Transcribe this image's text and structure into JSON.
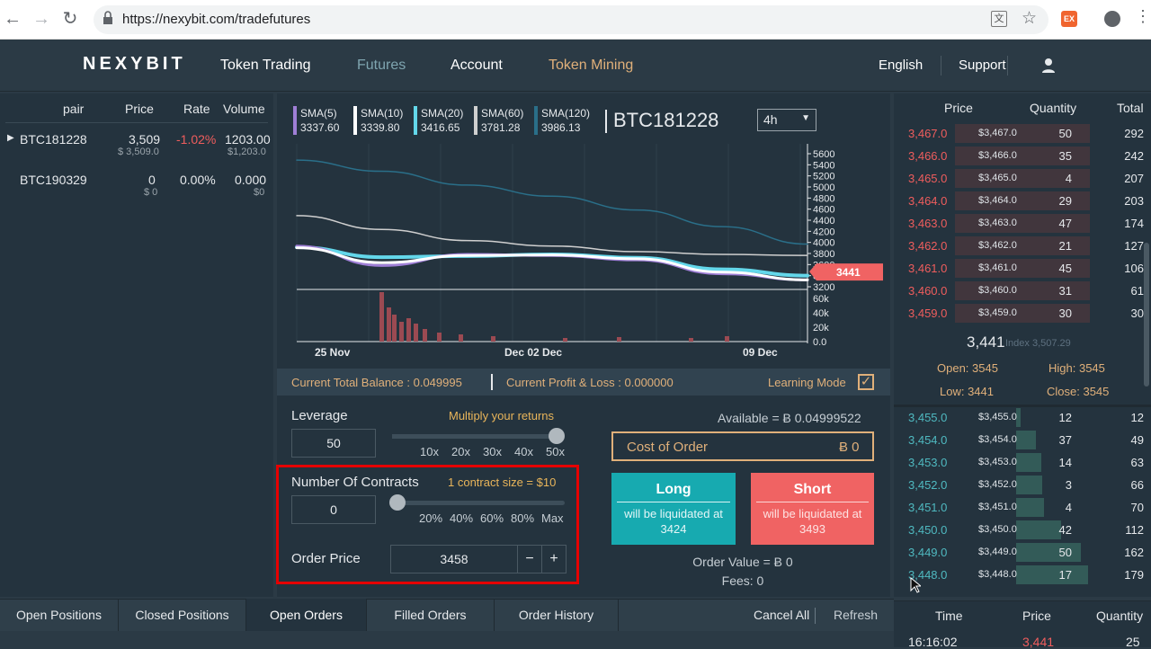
{
  "browser": {
    "url": "https://nexybit.com/tradefutures"
  },
  "header": {
    "logo": "NEXYBIT",
    "nav": [
      "Token Trading",
      "Futures",
      "Account",
      "Token Mining"
    ],
    "language": "English",
    "support": "Support"
  },
  "pairs": {
    "headers": [
      "pair",
      "Price",
      "Rate",
      "Volume"
    ],
    "rows": [
      {
        "pair": "BTC181228",
        "price": "3,509",
        "price_usd": "$ 3,509.0",
        "rate": "-1.02%",
        "volume": "1203.00",
        "volume_usd": "$1,203.0"
      },
      {
        "pair": "BTC190329",
        "price": "0",
        "price_usd": "$ 0",
        "rate": "0.00%",
        "volume": "0.000",
        "volume_usd": "$0"
      }
    ]
  },
  "chart": {
    "sma": [
      {
        "label": "SMA(5)",
        "value": "3337.60",
        "color": "#9f7fd6"
      },
      {
        "label": "SMA(10)",
        "value": "3339.80",
        "color": "#ffffff"
      },
      {
        "label": "SMA(20)",
        "value": "3416.65",
        "color": "#63d7ea"
      },
      {
        "label": "SMA(60)",
        "value": "3781.28",
        "color": "#cfcfcf"
      },
      {
        "label": "SMA(120)",
        "value": "3986.13",
        "color": "#2a6f89"
      }
    ],
    "symbol": "BTC181228",
    "interval": "4h",
    "last_price": "3441",
    "price_ticks": [
      "5600",
      "5400",
      "5200",
      "5000",
      "4800",
      "4600",
      "4400",
      "4200",
      "4000",
      "3800",
      "3600",
      "3400",
      "3200"
    ],
    "volume_ticks": [
      "60k",
      "40k",
      "20k",
      "0.0"
    ],
    "x_ticks": [
      "25 Nov",
      "Dec 02 Dec",
      "09 Dec"
    ]
  },
  "chart_data": {
    "type": "line",
    "title": "BTC181228",
    "x_ticks": [
      "25 Nov",
      "Dec 02 Dec",
      "09 Dec"
    ],
    "ylim": [
      3200,
      5600
    ],
    "series": [
      {
        "name": "SMA(5)",
        "values": [
          3950,
          3600,
          3800,
          3780,
          3700,
          3450,
          3340
        ]
      },
      {
        "name": "SMA(10)",
        "values": [
          3920,
          3650,
          3780,
          3790,
          3720,
          3480,
          3340
        ]
      },
      {
        "name": "SMA(20)",
        "values": [
          3930,
          3750,
          3770,
          3800,
          3740,
          3530,
          3417
        ]
      },
      {
        "name": "SMA(60)",
        "values": [
          4500,
          4250,
          4050,
          3950,
          3850,
          3800,
          3781
        ]
      },
      {
        "name": "SMA(120)",
        "values": [
          5500,
          5300,
          5050,
          4850,
          4600,
          4300,
          3986
        ]
      }
    ]
  },
  "balance": {
    "total": "Current Total Balance : 0.049995",
    "pnl": "Current Profit & Loss : 0.000000",
    "learning": "Learning Mode"
  },
  "form": {
    "leverage_label": "Leverage",
    "leverage_hint": "Multiply your returns",
    "leverage_value": "50",
    "leverage_marks": [
      "10x",
      "20x",
      "30x",
      "40x",
      "50x"
    ],
    "contracts_label": "Number Of Contracts",
    "contracts_hint": "1 contract size = $10",
    "contracts_value": "0",
    "contracts_marks": [
      "20%",
      "40%",
      "60%",
      "80%",
      "Max"
    ],
    "price_label": "Order Price",
    "price_value": "3458",
    "minus": "−",
    "plus": "+",
    "available": "Available = Ƀ 0.04999522",
    "cost_label": "Cost of Order",
    "cost_value": "Ƀ 0",
    "long": {
      "title": "Long",
      "sub": "will be liquidated at",
      "price": "3424"
    },
    "short": {
      "title": "Short",
      "sub": "will be liquidated at",
      "price": "3493"
    },
    "order_value": "Order Value = Ƀ 0",
    "fees": "Fees: 0"
  },
  "orderbook": {
    "headers": [
      "Price",
      "Quantity",
      "Total"
    ],
    "asks": [
      {
        "p": "3,467.0",
        "u": "$3,467.0",
        "q": "50",
        "t": "292"
      },
      {
        "p": "3,466.0",
        "u": "$3,466.0",
        "q": "35",
        "t": "242"
      },
      {
        "p": "3,465.0",
        "u": "$3,465.0",
        "q": "4",
        "t": "207"
      },
      {
        "p": "3,464.0",
        "u": "$3,464.0",
        "q": "29",
        "t": "203"
      },
      {
        "p": "3,463.0",
        "u": "$3,463.0",
        "q": "47",
        "t": "174"
      },
      {
        "p": "3,462.0",
        "u": "$3,462.0",
        "q": "21",
        "t": "127"
      },
      {
        "p": "3,461.0",
        "u": "$3,461.0",
        "q": "45",
        "t": "106"
      },
      {
        "p": "3,460.0",
        "u": "$3,460.0",
        "q": "31",
        "t": "61"
      },
      {
        "p": "3,459.0",
        "u": "$3,459.0",
        "q": "30",
        "t": "30"
      }
    ],
    "mid": {
      "price": "3,441",
      "index": "Index 3,507.29",
      "open": "Open: 3545",
      "high": "High: 3545",
      "low": "Low: 3441",
      "close": "Close: 3545"
    },
    "bids": [
      {
        "p": "3,455.0",
        "u": "$3,455.0",
        "q": "12",
        "t": "12"
      },
      {
        "p": "3,454.0",
        "u": "$3,454.0",
        "q": "37",
        "t": "49"
      },
      {
        "p": "3,453.0",
        "u": "$3,453.0",
        "q": "14",
        "t": "63"
      },
      {
        "p": "3,452.0",
        "u": "$3,452.0",
        "q": "3",
        "t": "66"
      },
      {
        "p": "3,451.0",
        "u": "$3,451.0",
        "q": "4",
        "t": "70"
      },
      {
        "p": "3,450.0",
        "u": "$3,450.0",
        "q": "42",
        "t": "112"
      },
      {
        "p": "3,449.0",
        "u": "$3,449.0",
        "q": "50",
        "t": "162"
      },
      {
        "p": "3,448.0",
        "u": "$3,448.0",
        "q": "17",
        "t": "179"
      }
    ]
  },
  "trades": {
    "headers": [
      "Time",
      "Price",
      "Quantity"
    ],
    "row": {
      "time": "16:16:02",
      "price": "3,441",
      "qty": "25"
    }
  },
  "tabs": [
    "Open Positions",
    "Closed Positions",
    "Open Orders",
    "Filled Orders",
    "Order History"
  ],
  "actions": {
    "cancel_all": "Cancel All",
    "refresh": "Refresh"
  }
}
